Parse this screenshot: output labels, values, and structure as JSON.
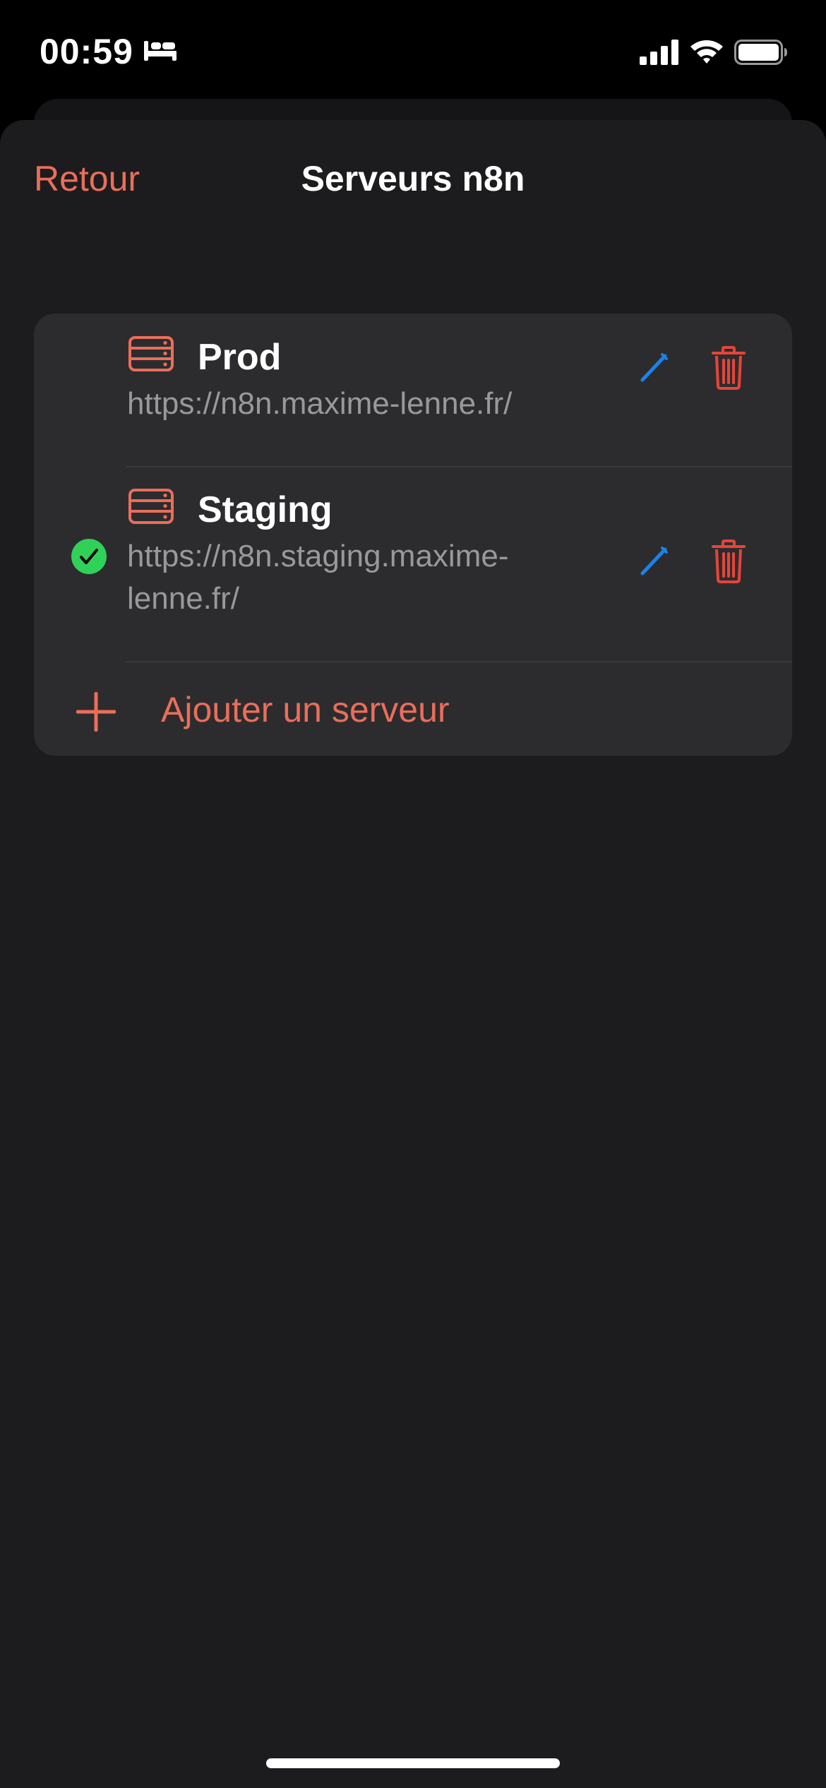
{
  "status_bar": {
    "time": "00:59",
    "icons": [
      "bed-icon",
      "cellular-signal-icon",
      "wifi-icon",
      "battery-icon"
    ]
  },
  "nav": {
    "back_label": "Retour",
    "title": "Serveurs n8n"
  },
  "servers": [
    {
      "name": "Prod",
      "url": "https://n8n.maxime-lenne.fr/",
      "active": false,
      "icon": "server-icon"
    },
    {
      "name": "Staging",
      "url": "https://n8n.staging.maxime-lenne.fr/",
      "active": true,
      "icon": "server-icon"
    }
  ],
  "add_server": {
    "label": "Ajouter un serveur",
    "icon": "plus-icon"
  },
  "colors": {
    "accent": "#ea6e5a",
    "edit": "#1a82ea",
    "delete": "#e5453a",
    "active_check": "#30d158",
    "background": "#1c1c1e",
    "card": "#2c2c2e"
  }
}
